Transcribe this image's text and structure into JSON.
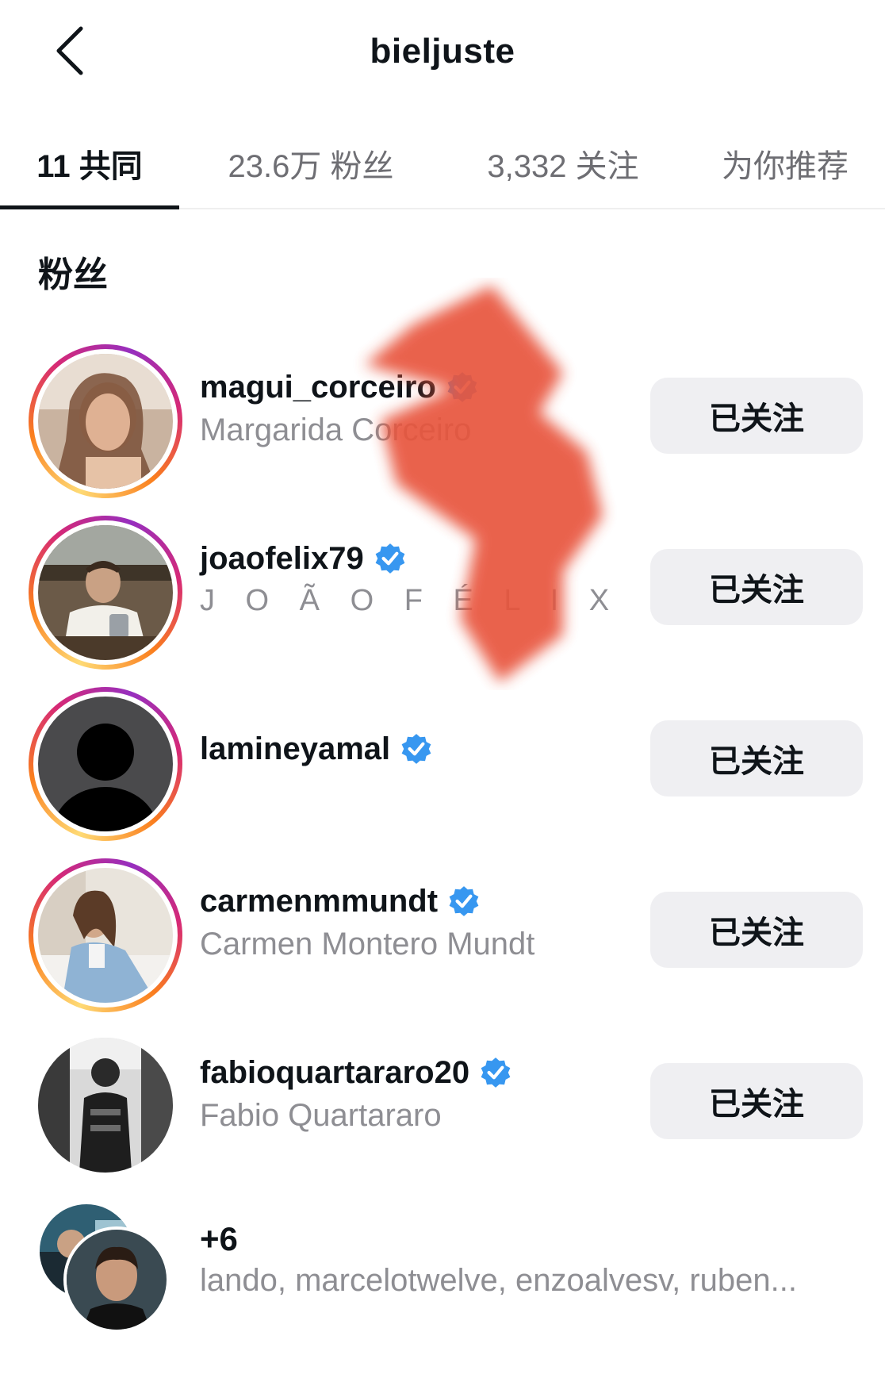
{
  "header": {
    "back_icon": "chevron-left-icon",
    "title": "bieljuste"
  },
  "tabs": [
    {
      "label": "11 共同",
      "active": true
    },
    {
      "label": "23.6万 粉丝",
      "active": false
    },
    {
      "label": "3,332 关注",
      "active": false
    },
    {
      "label": "为你推荐",
      "active": false
    }
  ],
  "section": {
    "title": "粉丝"
  },
  "users": [
    {
      "username": "magui_corceiro",
      "full_name": "Margarida Corceiro",
      "verified": true,
      "button": "已关注"
    },
    {
      "username": "joaofelix79",
      "full_name": "J O Ã O  F É L I X",
      "verified": true,
      "button": "已关注"
    },
    {
      "username": "lamineyamal",
      "full_name": "",
      "verified": true,
      "button": "已关注"
    },
    {
      "username": "carmenmmundt",
      "full_name": "Carmen Montero Mundt",
      "verified": true,
      "button": "已关注"
    },
    {
      "username": "fabioquartararo20",
      "full_name": "Fabio Quartararo",
      "verified": true,
      "button": "已关注"
    }
  ],
  "more": {
    "count": "+6",
    "names": "lando, marcelotwelve, enzoalvesv, ruben..."
  },
  "colors": {
    "verified_blue": "#3797f0",
    "button_bg": "#efeff2",
    "secondary_text": "#8e8e93",
    "redaction": "#e8553c"
  }
}
